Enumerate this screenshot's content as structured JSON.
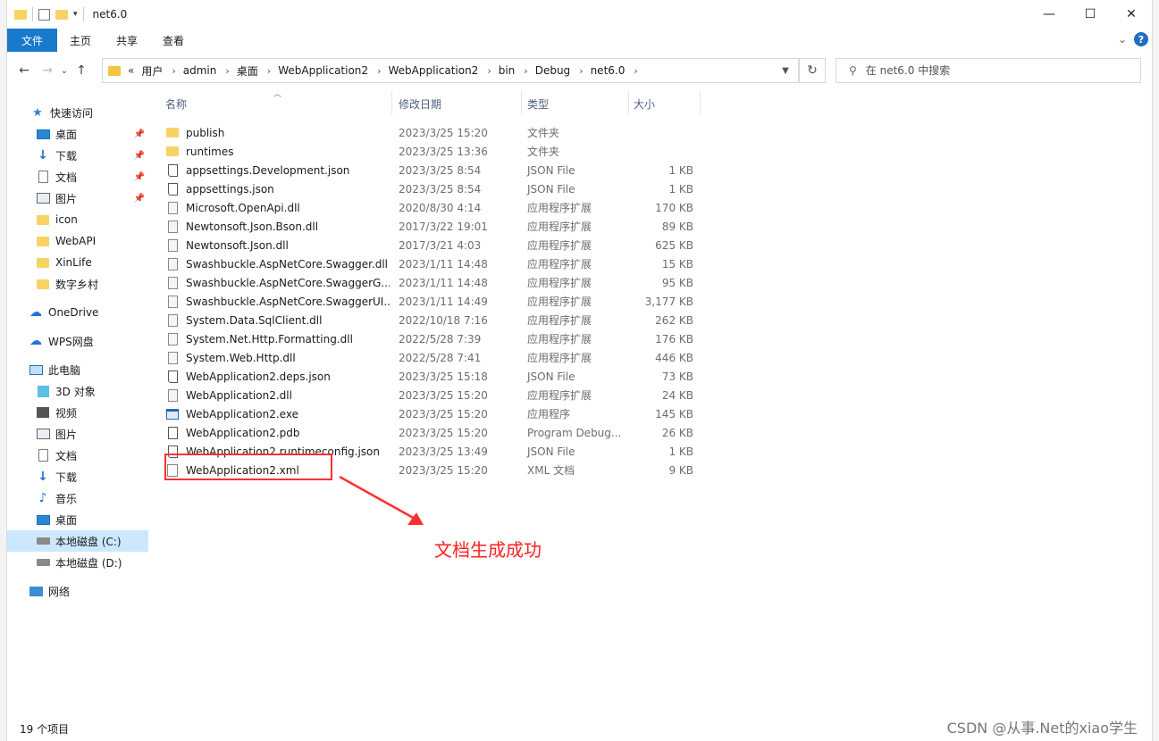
{
  "window": {
    "title": "net6.0",
    "controls": {
      "minimize": "—",
      "maximize": "☐",
      "close": "✕"
    }
  },
  "ribbon": {
    "tabs": [
      "文件",
      "主页",
      "共享",
      "查看"
    ],
    "expand": "⌄",
    "help": "?"
  },
  "nav": {
    "back": "←",
    "forward": "→",
    "recent": "⌄",
    "up": "↑",
    "breadcrumb_lead": "«",
    "breadcrumb": [
      "用户",
      "admin",
      "桌面",
      "WebApplication2",
      "WebApplication2",
      "bin",
      "Debug",
      "net6.0"
    ],
    "search_placeholder": "在 net6.0 中搜索"
  },
  "sidebar": {
    "quick_access": "快速访问",
    "quick_items": [
      {
        "label": "桌面",
        "icon": "desktop-icon",
        "pinned": true
      },
      {
        "label": "下载",
        "icon": "download-icon",
        "pinned": true
      },
      {
        "label": "文档",
        "icon": "document-icon",
        "pinned": true
      },
      {
        "label": "图片",
        "icon": "picture-icon",
        "pinned": true
      },
      {
        "label": "icon",
        "icon": "folder-icon",
        "pinned": false
      },
      {
        "label": "WebAPI",
        "icon": "folder-icon",
        "pinned": false
      },
      {
        "label": "XinLife",
        "icon": "folder-icon",
        "pinned": false
      },
      {
        "label": "数字乡村",
        "icon": "folder-icon",
        "pinned": false
      }
    ],
    "onedrive": "OneDrive",
    "wps": "WPS网盘",
    "this_pc": "此电脑",
    "pc_items": [
      {
        "label": "3D 对象",
        "icon": "cube-icon"
      },
      {
        "label": "视频",
        "icon": "video-icon"
      },
      {
        "label": "图片",
        "icon": "picture-icon"
      },
      {
        "label": "文档",
        "icon": "document-icon"
      },
      {
        "label": "下载",
        "icon": "download-icon"
      },
      {
        "label": "音乐",
        "icon": "music-icon"
      },
      {
        "label": "桌面",
        "icon": "desktop-icon"
      },
      {
        "label": "本地磁盘 (C:)",
        "icon": "drive-icon",
        "selected": true
      },
      {
        "label": "本地磁盘 (D:)",
        "icon": "drive-icon"
      }
    ],
    "network": "网络"
  },
  "columns": {
    "name": "名称",
    "date": "修改日期",
    "type": "类型",
    "size": "大小"
  },
  "files": [
    {
      "name": "publish",
      "date": "2023/3/25 15:20",
      "type": "文件夹",
      "size": "",
      "icon": "folder"
    },
    {
      "name": "runtimes",
      "date": "2023/3/25 13:36",
      "type": "文件夹",
      "size": "",
      "icon": "folder"
    },
    {
      "name": "appsettings.Development.json",
      "date": "2023/3/25 8:54",
      "type": "JSON File",
      "size": "1 KB",
      "icon": "json"
    },
    {
      "name": "appsettings.json",
      "date": "2023/3/25 8:54",
      "type": "JSON File",
      "size": "1 KB",
      "icon": "json"
    },
    {
      "name": "Microsoft.OpenApi.dll",
      "date": "2020/8/30 4:14",
      "type": "应用程序扩展",
      "size": "170 KB",
      "icon": "dll"
    },
    {
      "name": "Newtonsoft.Json.Bson.dll",
      "date": "2017/3/22 19:01",
      "type": "应用程序扩展",
      "size": "89 KB",
      "icon": "dll"
    },
    {
      "name": "Newtonsoft.Json.dll",
      "date": "2017/3/21 4:03",
      "type": "应用程序扩展",
      "size": "625 KB",
      "icon": "dll"
    },
    {
      "name": "Swashbuckle.AspNetCore.Swagger.dll",
      "date": "2023/1/11 14:48",
      "type": "应用程序扩展",
      "size": "15 KB",
      "icon": "dll"
    },
    {
      "name": "Swashbuckle.AspNetCore.SwaggerG...",
      "date": "2023/1/11 14:48",
      "type": "应用程序扩展",
      "size": "95 KB",
      "icon": "dll"
    },
    {
      "name": "Swashbuckle.AspNetCore.SwaggerUI...",
      "date": "2023/1/11 14:49",
      "type": "应用程序扩展",
      "size": "3,177 KB",
      "icon": "dll"
    },
    {
      "name": "System.Data.SqlClient.dll",
      "date": "2022/10/18 7:16",
      "type": "应用程序扩展",
      "size": "262 KB",
      "icon": "dll"
    },
    {
      "name": "System.Net.Http.Formatting.dll",
      "date": "2022/5/28 7:39",
      "type": "应用程序扩展",
      "size": "176 KB",
      "icon": "dll"
    },
    {
      "name": "System.Web.Http.dll",
      "date": "2022/5/28 7:41",
      "type": "应用程序扩展",
      "size": "446 KB",
      "icon": "dll"
    },
    {
      "name": "WebApplication2.deps.json",
      "date": "2023/3/25 15:18",
      "type": "JSON File",
      "size": "73 KB",
      "icon": "json"
    },
    {
      "name": "WebApplication2.dll",
      "date": "2023/3/25 15:20",
      "type": "应用程序扩展",
      "size": "24 KB",
      "icon": "dll"
    },
    {
      "name": "WebApplication2.exe",
      "date": "2023/3/25 15:20",
      "type": "应用程序",
      "size": "145 KB",
      "icon": "exe"
    },
    {
      "name": "WebApplication2.pdb",
      "date": "2023/3/25 15:20",
      "type": "Program Debug...",
      "size": "26 KB",
      "icon": "pdb"
    },
    {
      "name": "WebApplication2.runtimeconfig.json",
      "date": "2023/3/25 13:49",
      "type": "JSON File",
      "size": "1 KB",
      "icon": "json"
    },
    {
      "name": "WebApplication2.xml",
      "date": "2023/3/25 15:20",
      "type": "XML 文档",
      "size": "9 KB",
      "icon": "xml"
    }
  ],
  "annotation": {
    "text": "文档生成成功",
    "color": "#ff2020"
  },
  "status": {
    "item_count": "19 个项目"
  },
  "watermark": "CSDN @从事.Net的xiao学生",
  "colors": {
    "accent": "#1979ca",
    "selection": "#cce8ff",
    "highlight": "#ff2f2f"
  }
}
